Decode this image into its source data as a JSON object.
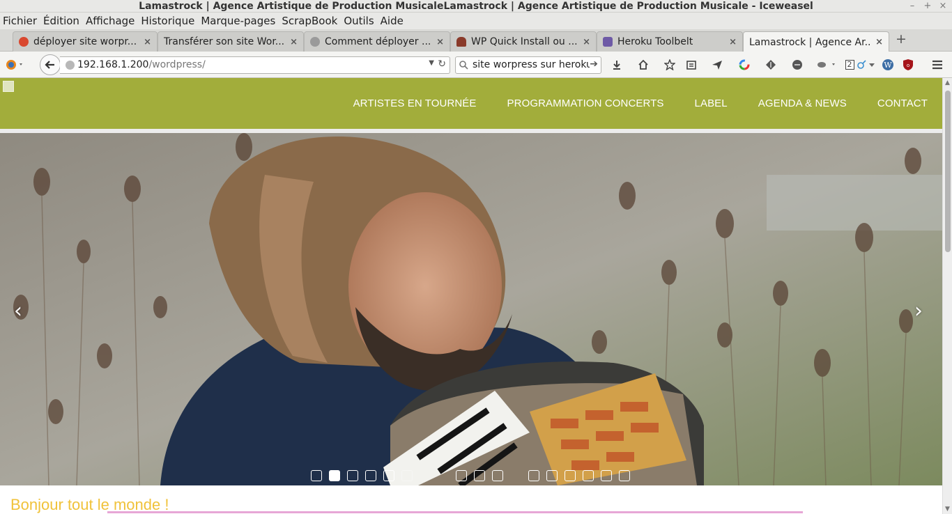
{
  "window": {
    "title": "Lamastrock | Agence Artistique de Production MusicaleLamastrock | Agence Artistique de Production Musicale - Iceweasel",
    "controls": [
      "–",
      "+",
      "×"
    ]
  },
  "menu": [
    "Fichier",
    "Édition",
    "Affichage",
    "Historique",
    "Marque-pages",
    "ScrapBook",
    "Outils",
    "Aide"
  ],
  "tabs": [
    {
      "label": "déployer site worpr...",
      "icon": "google-icon",
      "color": "#d9482f"
    },
    {
      "label": "Transférer son site Wor...",
      "icon": "blank-page-icon",
      "color": "#cdcdca"
    },
    {
      "label": "Comment déployer ...",
      "icon": "star-burst-icon",
      "color": "#999999"
    },
    {
      "label": "WP Quick Install ou ...",
      "icon": "helmet-icon",
      "color": "#8a3a2a"
    },
    {
      "label": "Heroku Toolbelt",
      "icon": "heroku-icon",
      "color": "#6e5aa6"
    },
    {
      "label": "Lamastrock | Agence Ar...",
      "icon": "none",
      "color": "#f4f4f2"
    }
  ],
  "close_glyph": "×",
  "newtab_glyph": "+",
  "nav": {
    "url_host": "192.168.1.200",
    "url_path": "/wordpress/",
    "search_text": "site worpress sur heroku",
    "badge_count": "2"
  },
  "site": {
    "menu": [
      "ARTISTES EN TOURNÉE",
      "PROGRAMMATION CONCERTS",
      "LABEL",
      "AGENDA & NEWS",
      "CONTACT"
    ],
    "header_color": "#a2ad3b",
    "slider": {
      "prev_glyph": "‹",
      "next_glyph": "›",
      "active_dot": 2,
      "visible_dots": [
        1,
        2,
        3,
        4,
        5,
        6,
        9,
        10,
        11,
        13,
        14,
        15,
        16,
        17,
        18
      ]
    },
    "post_title": "Bonjour tout le monde !",
    "post_title_color": "#f0c23a"
  }
}
